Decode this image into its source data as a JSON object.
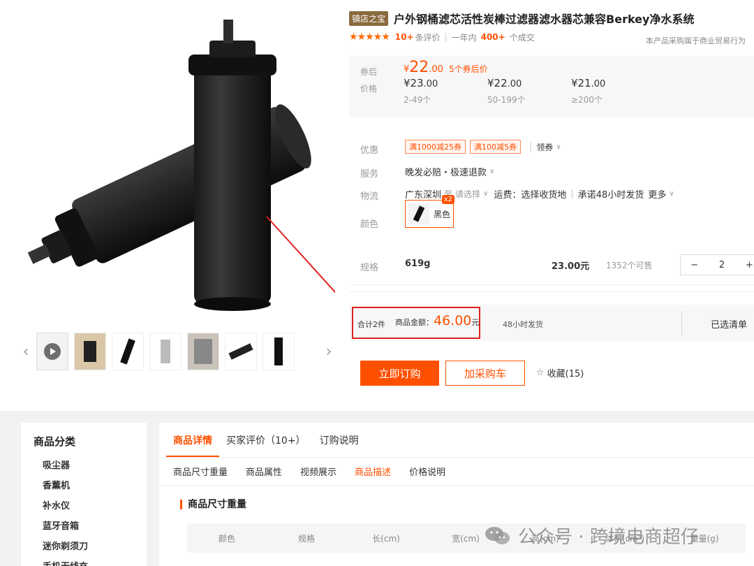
{
  "product": {
    "shop_tag": "镇店之宝",
    "title": "户外钢桶滤芯活性炭棒过滤器滤水器芯兼容Berkey净水系统",
    "stars": "★★★★★",
    "review_count": "10+",
    "review_label": "条评价",
    "sales_prefix": "一年内",
    "sales_count": "400+",
    "sales_label": "个成交",
    "notice": "本产品采购属于商业贸易行为"
  },
  "price": {
    "coupon_label": "券后",
    "price_label": "价格",
    "coupon_price_symbol": "¥",
    "coupon_price_int": "22",
    "coupon_price_dec": ".00",
    "coupon_tip": "5个券后价",
    "tiers": [
      {
        "int": "¥23",
        "dec": ".00",
        "qty": "2-49个"
      },
      {
        "int": "¥22",
        "dec": ".00",
        "qty": "50-199个"
      },
      {
        "int": "¥21",
        "dec": ".00",
        "qty": "≥200个"
      }
    ]
  },
  "rows": {
    "discount_label": "优惠",
    "promo1": "满1000减25券",
    "promo2": "满100减5券",
    "get_coupon": "领券",
    "service_label": "服务",
    "service_text": "晚发必赔・极速退款",
    "logistics_label": "物流",
    "origin": "广东深圳",
    "to": "至",
    "choose": "请选择",
    "freight": "运费：选择收货地",
    "promise": "承诺48小时发货",
    "more": "更多",
    "color_label": "颜色",
    "color_name": "黑色",
    "color_badge": "x2"
  },
  "spec": {
    "label": "规格",
    "name": "619g",
    "price": "23.00元",
    "stock": "1352个可售",
    "minus": "−",
    "qty": "2",
    "plus": "+"
  },
  "summary": {
    "count": "合计2件",
    "amount_label": "商品金额：",
    "amount": "46.00",
    "unit": "元",
    "ship": "48小时发货",
    "selected": "已选清单"
  },
  "actions": {
    "buy": "立即订购",
    "cart": "加采购车",
    "fav": "收藏(15)"
  },
  "categories": {
    "title": "商品分类",
    "items": [
      "吸尘器",
      "香薰机",
      "补水仪",
      "蓝牙音箱",
      "迷你剃须刀",
      "手机无线充"
    ]
  },
  "detail": {
    "tabs": [
      "商品详情",
      "买家评价（10+）",
      "订购说明"
    ],
    "subtabs": [
      "商品尺寸重量",
      "商品属性",
      "视频展示",
      "商品描述",
      "价格说明"
    ],
    "section_title": "商品尺寸重量",
    "columns": [
      "颜色",
      "规格",
      "长(cm)",
      "宽(cm)",
      "高(cm)",
      "体积(cm³)",
      "重量(g)"
    ]
  },
  "watermark": {
    "text": "公众号 · 跨境电商超仔"
  },
  "colors": {
    "accent": "#ff5000",
    "highlight_box": "#e02020",
    "shop_tag": "#8a6a3e"
  }
}
